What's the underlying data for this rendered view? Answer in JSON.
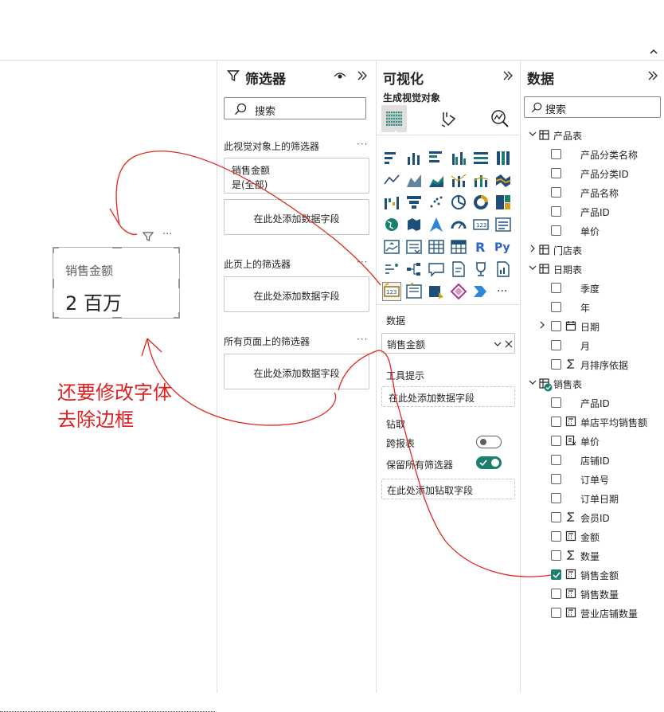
{
  "canvas": {
    "card": {
      "title": "销售金额",
      "value": "2 百万"
    },
    "annotation": {
      "line1": "还要修改字体",
      "line2": "去除边框"
    }
  },
  "filters": {
    "title": "筛选器",
    "search_placeholder": "搜索",
    "visual_section": "此视觉对象上的筛选器",
    "visual_filter": {
      "field": "销售金额",
      "condition": "是(全部)"
    },
    "add_field": "在此处添加数据字段",
    "page_section": "此页上的筛选器",
    "all_pages_section": "所有页面上的筛选器",
    "more": "···"
  },
  "viz": {
    "title": "可视化",
    "subtitle": "生成视觉对象",
    "data_label": "数据",
    "data_field": "销售金额",
    "tooltips_label": "工具提示",
    "tooltips_placeholder": "在此处添加数据字段",
    "drillthrough_label": "钻取",
    "cross_report_label": "跨报表",
    "cross_report_on": false,
    "keep_filters_label": "保留所有筛选器",
    "keep_filters_on": true,
    "drillthrough_placeholder": "在此处添加钻取字段",
    "icon_r": "R",
    "icon_py": "Py",
    "icon_more": "···",
    "accent": "#1a7f6f"
  },
  "data": {
    "title": "数据",
    "search_placeholder": "搜索",
    "tables": [
      {
        "name": "产品表",
        "fields": [
          "产品分类名称",
          "产品分类ID",
          "产品名称",
          "产品ID",
          "单价"
        ]
      },
      {
        "name": "门店表"
      },
      {
        "name": "日期表",
        "fields": [
          "季度",
          "年",
          "日期",
          "月",
          "月排序依据"
        ]
      },
      {
        "name": "销售表",
        "fields": [
          "产品ID",
          "单店平均销售额",
          "单价",
          "店铺ID",
          "订单号",
          "订单日期",
          "会员ID",
          "金额",
          "数量",
          "销售金额",
          "销售数量",
          "营业店铺数量"
        ]
      }
    ]
  }
}
